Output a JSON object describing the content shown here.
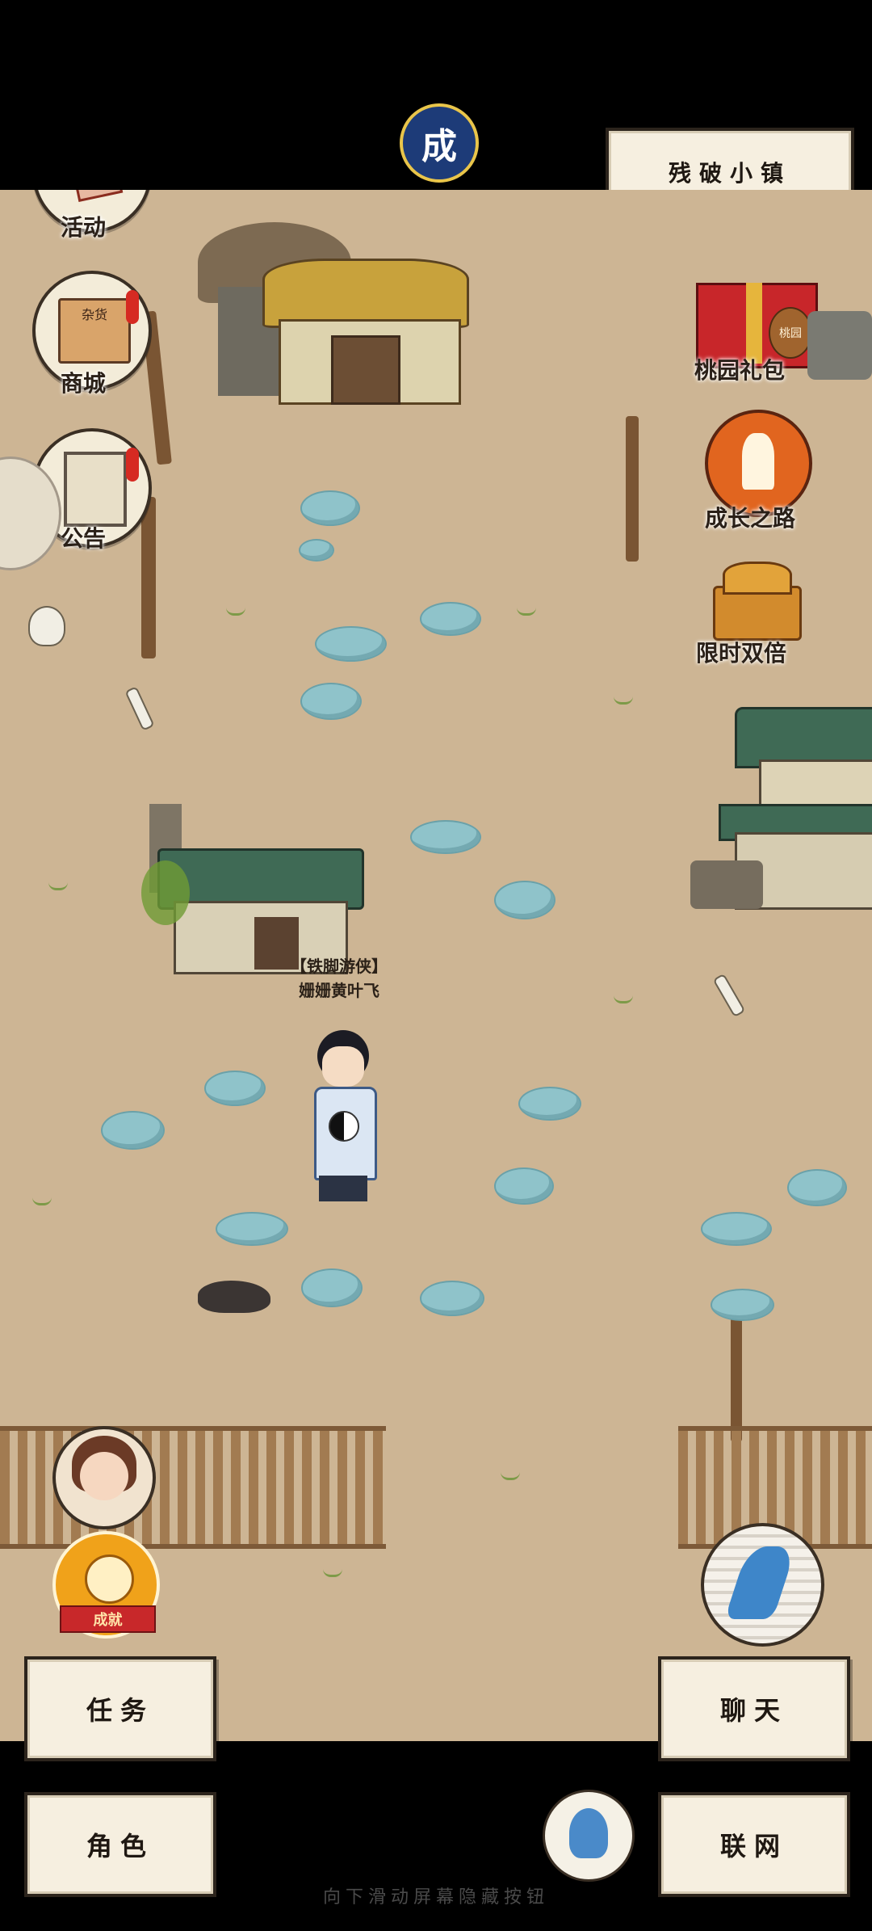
{
  "top": {
    "location_label": "残破小镇",
    "badge_char": "成"
  },
  "left_menu": {
    "activity": "活动",
    "shop": "商城",
    "notice": "公告"
  },
  "right_menu": {
    "gift": "桃园礼包",
    "growth": "成长之路",
    "double": "限时双倍"
  },
  "gift_tag": "桃园",
  "shop_sign": "杂货",
  "player": {
    "title": "【铁脚游侠】",
    "name": "姗姗黄叶飞"
  },
  "achievement_label": "成就",
  "bottom": {
    "task": "任务",
    "chat": "聊天",
    "role": "角色",
    "network": "联网",
    "hint": "向下滑动屏幕隐藏按钮"
  },
  "colors": {
    "ground": "#cdb594",
    "panel": "#f6efe0",
    "stone": "#8fc3ca"
  }
}
